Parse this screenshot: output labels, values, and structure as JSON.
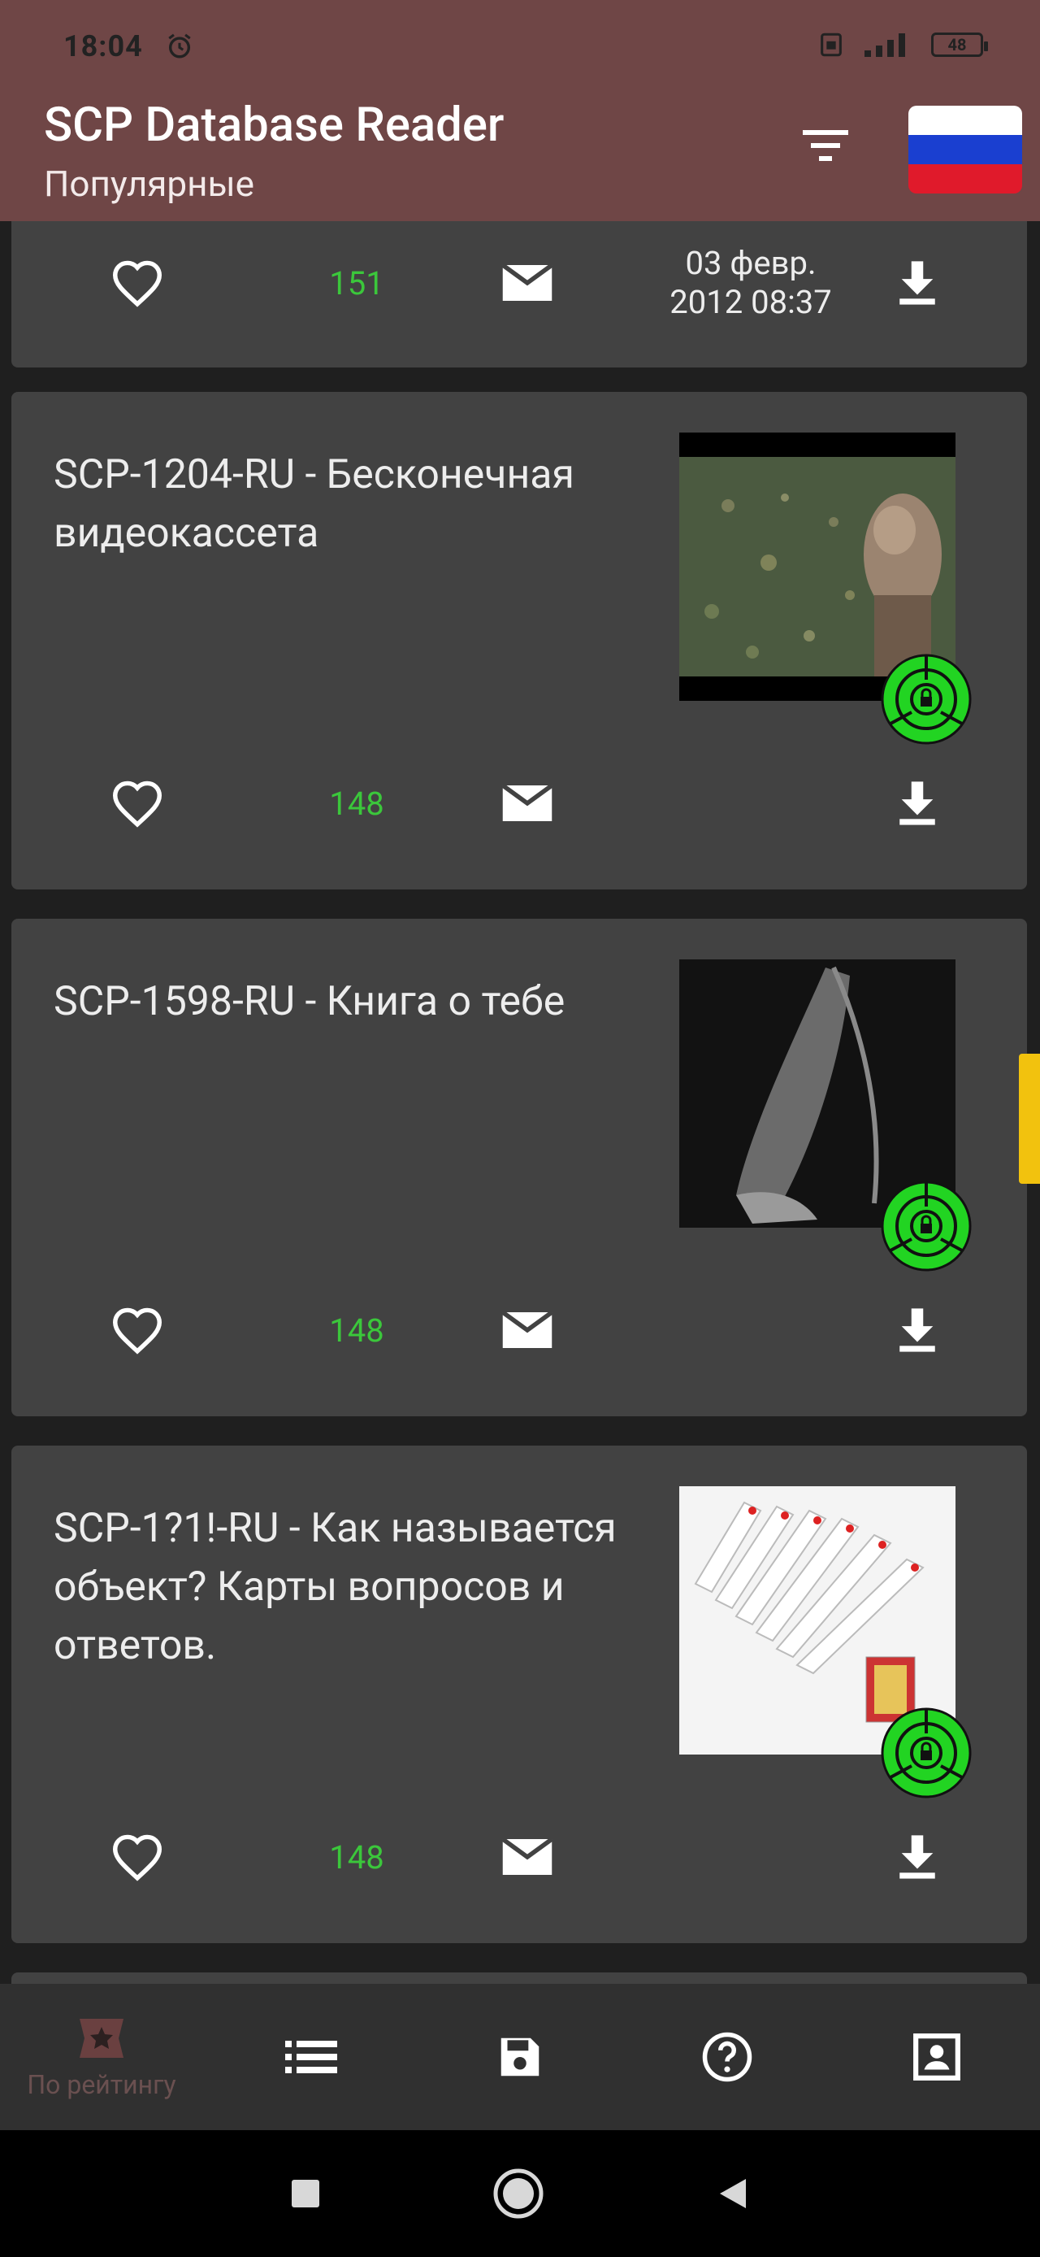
{
  "status_bar": {
    "time": "18:04",
    "battery": "48"
  },
  "app_bar": {
    "title": "SCP Database Reader",
    "subtitle": "Популярные"
  },
  "cards": [
    {
      "likes": "151",
      "date_line1": "03 февр.",
      "date_line2": "2012 08:37"
    },
    {
      "title": "SCP-1204-RU - Бесконечная видеокассета",
      "likes": "148"
    },
    {
      "title": "SCP-1598-RU - Книга о тебе",
      "likes": "148"
    },
    {
      "title": "SCP-1?1!-RU - Как называется объект? Карты вопросов и ответов.",
      "likes": "148"
    }
  ],
  "bottom_nav": {
    "items": [
      {
        "label": "По рейтингу",
        "icon": "star-badge-icon"
      },
      {
        "label": "",
        "icon": "list-icon"
      },
      {
        "label": "",
        "icon": "save-icon"
      },
      {
        "label": "",
        "icon": "help-icon"
      },
      {
        "label": "",
        "icon": "account-box-icon"
      }
    ]
  },
  "colors": {
    "app_bar": "#6f4646",
    "card_bg": "#424242",
    "count_green": "#3bc73b",
    "scroll_indicator": "#f2c20e",
    "badge_green": "#22d422"
  }
}
